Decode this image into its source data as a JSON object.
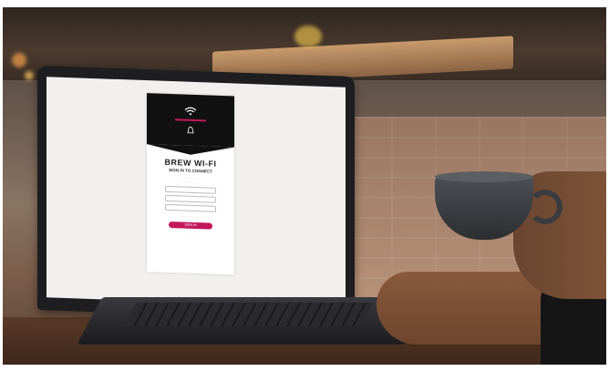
{
  "portal": {
    "title": "BREW WI-FI",
    "subtitle": "SIGN IN TO CONNECT",
    "button": "SIGN IN"
  }
}
